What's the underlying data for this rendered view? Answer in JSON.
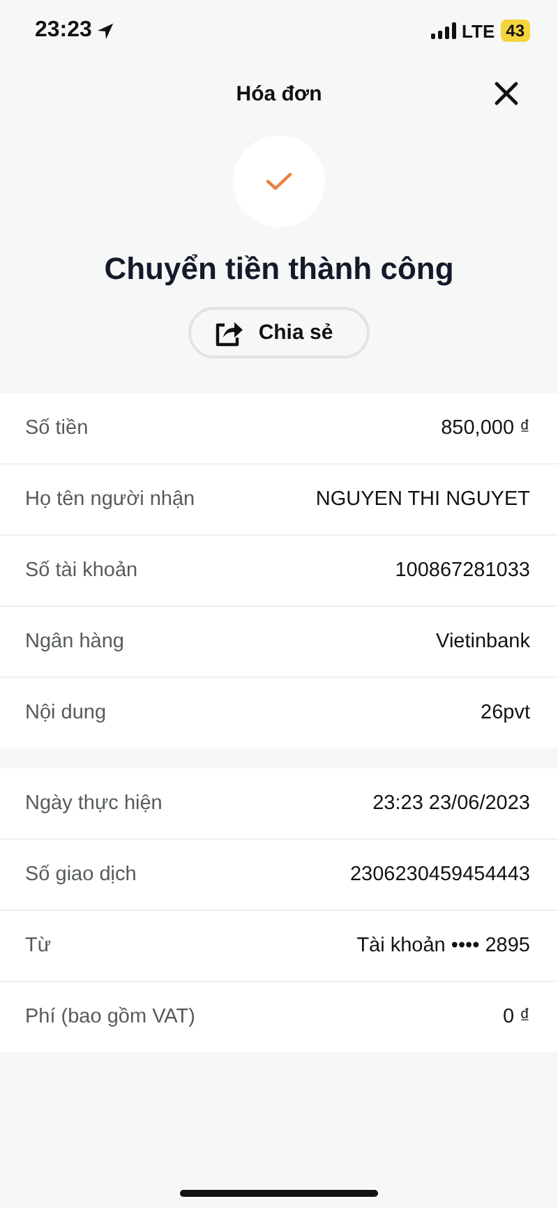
{
  "status_bar": {
    "time": "23:23",
    "network": "LTE",
    "battery": "43"
  },
  "header": {
    "title": "Hóa đơn"
  },
  "result": {
    "title": "Chuyển tiền thành công",
    "share_button": "Chia sẻ"
  },
  "sections": [
    {
      "rows": [
        {
          "label": "Số tiền",
          "value": "850,000 ₫"
        },
        {
          "label": "Họ tên người nhận",
          "value": "NGUYEN THI NGUYET"
        },
        {
          "label": "Số tài khoản",
          "value": "100867281033"
        },
        {
          "label": "Ngân hàng",
          "value": "Vietinbank"
        },
        {
          "label": "Nội dung",
          "value": "26pvt"
        }
      ]
    },
    {
      "rows": [
        {
          "label": "Ngày thực hiện",
          "value": "23:23 23/06/2023"
        },
        {
          "label": "Số giao dịch",
          "value": "2306230459454443"
        },
        {
          "label": "Từ",
          "value": "Tài khoản •••• 2895"
        },
        {
          "label": "Phí (bao gồm VAT)",
          "value": "0 ₫"
        }
      ]
    }
  ]
}
